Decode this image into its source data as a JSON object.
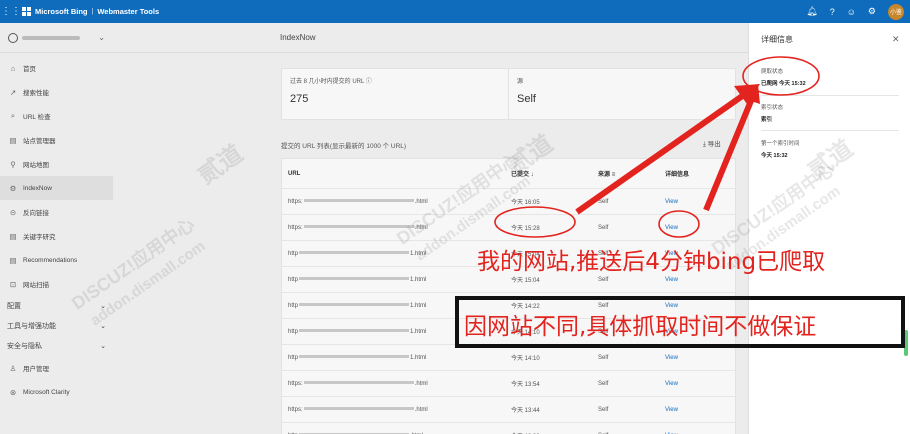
{
  "topbar": {
    "brand": "Microsoft Bing",
    "product": "Webmaster Tools",
    "avatar_text": "小鉴",
    "accent": "#0f6cbd"
  },
  "sidebar": {
    "items": [
      {
        "label": "首页",
        "icon": "home-icon"
      },
      {
        "label": "搜索性能",
        "icon": "trend-icon"
      },
      {
        "label": "URL 检查",
        "icon": "search-icon"
      },
      {
        "label": "站点管理器",
        "icon": "document-icon"
      },
      {
        "label": "网站地图",
        "icon": "sitemap-icon"
      },
      {
        "label": "IndexNow",
        "icon": "gear-icon"
      },
      {
        "label": "反向链接",
        "icon": "link-icon"
      },
      {
        "label": "关键字研究",
        "icon": "document-icon"
      },
      {
        "label": "Recommendations",
        "icon": "document-icon"
      },
      {
        "label": "网站扫描",
        "icon": "scan-icon"
      }
    ],
    "groups": [
      "配置",
      "工具与增强功能",
      "安全与隐私"
    ],
    "footer_items": [
      {
        "label": "用户管理",
        "icon": "user-icon"
      },
      {
        "label": "Microsoft Clarity",
        "icon": "clarity-icon"
      }
    ]
  },
  "main": {
    "header_title": "IndexNow",
    "card": {
      "label1": "过去 8 几小时内提交的 URL ⓘ",
      "value1": "275",
      "label2": "源",
      "value2": "Self"
    },
    "list_title": "提交的 URL 列表(显示最新的 1000 个 URL)",
    "export_label": "导出",
    "table": {
      "headers": [
        "URL",
        "已提交 ↓",
        "来源",
        "详细信息"
      ],
      "rows": [
        {
          "prefix": "https:",
          "suffix": ".html",
          "time": "今天 16:05",
          "source": "Self",
          "view": "View"
        },
        {
          "prefix": "https:",
          "suffix": ".html",
          "time": "今天 15:28",
          "source": "Self",
          "view": "View"
        },
        {
          "prefix": "http",
          "suffix": "1.html",
          "time": "今天 15:04",
          "source": "Self",
          "view": "View"
        },
        {
          "prefix": "http",
          "suffix": "1.html",
          "time": "今天 15:04",
          "source": "Self",
          "view": "View"
        },
        {
          "prefix": "http",
          "suffix": "1.html",
          "time": "今天 14:22",
          "source": "Self",
          "view": "View"
        },
        {
          "prefix": "http",
          "suffix": "1.html",
          "time": "今天 14:10",
          "source": "Self",
          "view": "View"
        },
        {
          "prefix": "http",
          "suffix": "1.html",
          "time": "今天 14:10",
          "source": "Self",
          "view": "View"
        },
        {
          "prefix": "https:",
          "suffix": ".html",
          "time": "今天 13:54",
          "source": "Self",
          "view": "View"
        },
        {
          "prefix": "https:",
          "suffix": ".html",
          "time": "今天 13:44",
          "source": "Self",
          "view": "View"
        },
        {
          "prefix": "http",
          "suffix": ".html",
          "time": "今天 13:33",
          "source": "Self",
          "view": "View"
        }
      ]
    }
  },
  "panel": {
    "title": "详细信息",
    "crawl_label": "爬取状态",
    "crawl_value": "已爬网 今天 15:32",
    "index_label": "索引状态",
    "index_value": "索引",
    "first_index_label": "第一个索引时间",
    "first_index_value": "今天 15:32"
  },
  "watermark": {
    "line1": "DISCUZ!应用中心",
    "line2": "addon.dismall.com",
    "seal": "贰道"
  },
  "annotations": {
    "line1": "我的网站,推送后4分钟bing已爬取",
    "line2": "因网站不同,具体抓取时间不做保证",
    "color": "#e3231e"
  }
}
